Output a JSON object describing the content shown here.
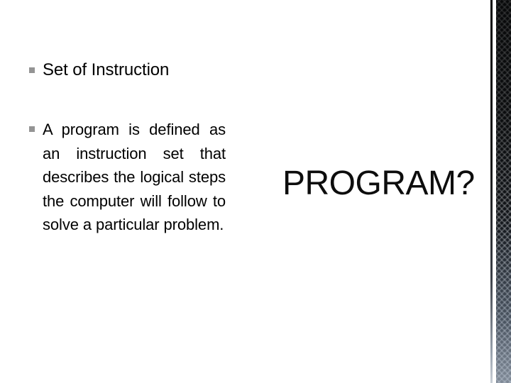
{
  "slide": {
    "background_color": "#ffffff",
    "bullet_color": "#949494",
    "text_color": "#000000"
  },
  "content": {
    "bullets": [
      {
        "text": "Set of Instruction"
      },
      {
        "text": "A program is defined as an instruction set that describes the logical steps the computer will follow to solve a particular problem."
      }
    ]
  },
  "callout": {
    "word": "PROGRAM?"
  },
  "decoration": {
    "edge_strip": {
      "line_color": "#0a0a0a",
      "band_color": "#0b0c0d",
      "band_fade_color": "#c9cfd6"
    }
  }
}
